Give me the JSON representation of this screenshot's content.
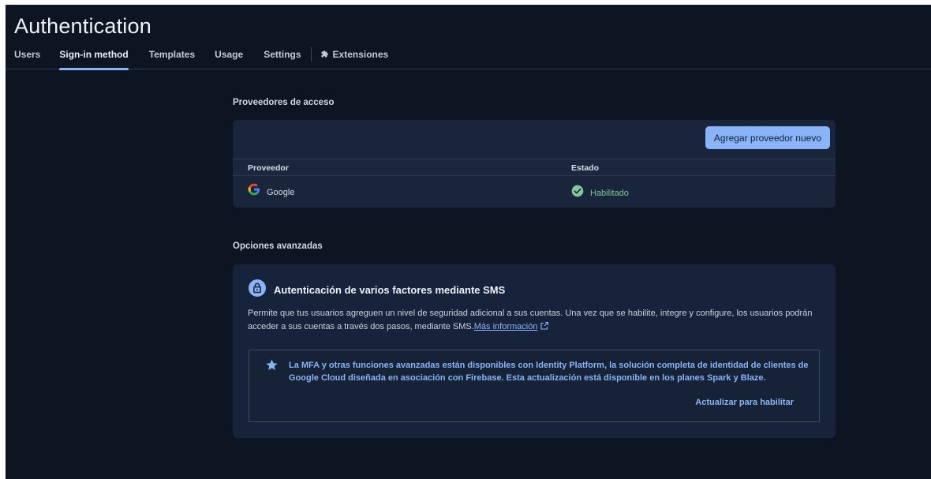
{
  "header": {
    "title": "Authentication",
    "tabs": [
      {
        "label": "Users"
      },
      {
        "label": "Sign-in method"
      },
      {
        "label": "Templates"
      },
      {
        "label": "Usage"
      },
      {
        "label": "Settings"
      },
      {
        "label": "Extensiones"
      }
    ],
    "active_tab": "Sign-in method"
  },
  "providers": {
    "section_label": "Proveedores de acceso",
    "add_button_label": "Agregar proveedor nuevo",
    "columns": [
      "Proveedor",
      "Estado"
    ],
    "rows": [
      {
        "provider": "Google",
        "provider_icon": "google-g-icon",
        "status": "Habilitado",
        "status_icon": "check-circle-icon"
      }
    ]
  },
  "advanced": {
    "section_label": "Opciones avanzadas",
    "mfa_title": "Autenticación de varios factores mediante SMS",
    "mfa_icon": "lock-icon",
    "mfa_description": "Permite que tus usuarios agreguen un nivel de seguridad adicional a sus cuentas. Una vez que se habilite, integre y configure, los usuarios podrán acceder a sus cuentas a través dos pasos, mediante SMS.",
    "more_info_link": "Más información",
    "info_box_text": "La MFA y otras funciones avanzadas están disponibles con Identity Platform, la solución completa de identidad de clientes de Google Cloud diseñada en asociación con Firebase. Esta actualización está disponible en los planes Spark y Blaze.",
    "upgrade_link": "Actualizar para habilitar"
  },
  "colors": {
    "background": "#0c1521",
    "card": "#16233a",
    "accent": "#8ab4f8",
    "success": "#81c995"
  }
}
